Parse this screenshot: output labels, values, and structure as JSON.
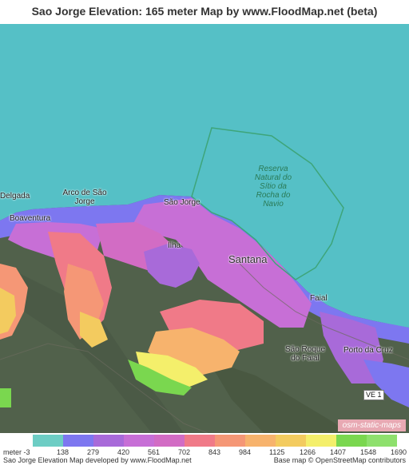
{
  "title": "Sao Jorge Elevation: 165 meter Map by www.FloodMap.net (beta)",
  "map": {
    "labels": {
      "delgada": "Delgada",
      "arco": "Arco de São Jorge",
      "boaventura": "Boaventura",
      "sao_jorge": "São Jorge",
      "ilha": "Ilha",
      "santana": "Santana",
      "faial": "Faial",
      "sao_roque": "São Roque do Faial",
      "porto_cruz": "Porto da Cruz",
      "reserve": "Reserva Natural do Sítio da Rocha do Navio",
      "road": "VE 1"
    },
    "attribution_badge": "osm-static-maps"
  },
  "legend": {
    "unit": "meter",
    "ticks": [
      "-3",
      "138",
      "279",
      "420",
      "561",
      "702",
      "843",
      "984",
      "1125",
      "1266",
      "1407",
      "1548",
      "1690"
    ],
    "colors": [
      "#6dcdc4",
      "#7d77f0",
      "#a86ad9",
      "#c76fd6",
      "#d26cc4",
      "#f07a88",
      "#f59776",
      "#f7b36d",
      "#f3cb5f",
      "#f4ef6b",
      "#7ad74f",
      "#8ee06d"
    ]
  },
  "footer": {
    "left": "Sao Jorge Elevation Map developed by www.FloodMap.net",
    "right": "Base map © OpenStreetMap contributors"
  },
  "colors": {
    "sea": "#55c0c6",
    "land_green": "#51614b",
    "reserve_outline": "#3ea57a"
  }
}
